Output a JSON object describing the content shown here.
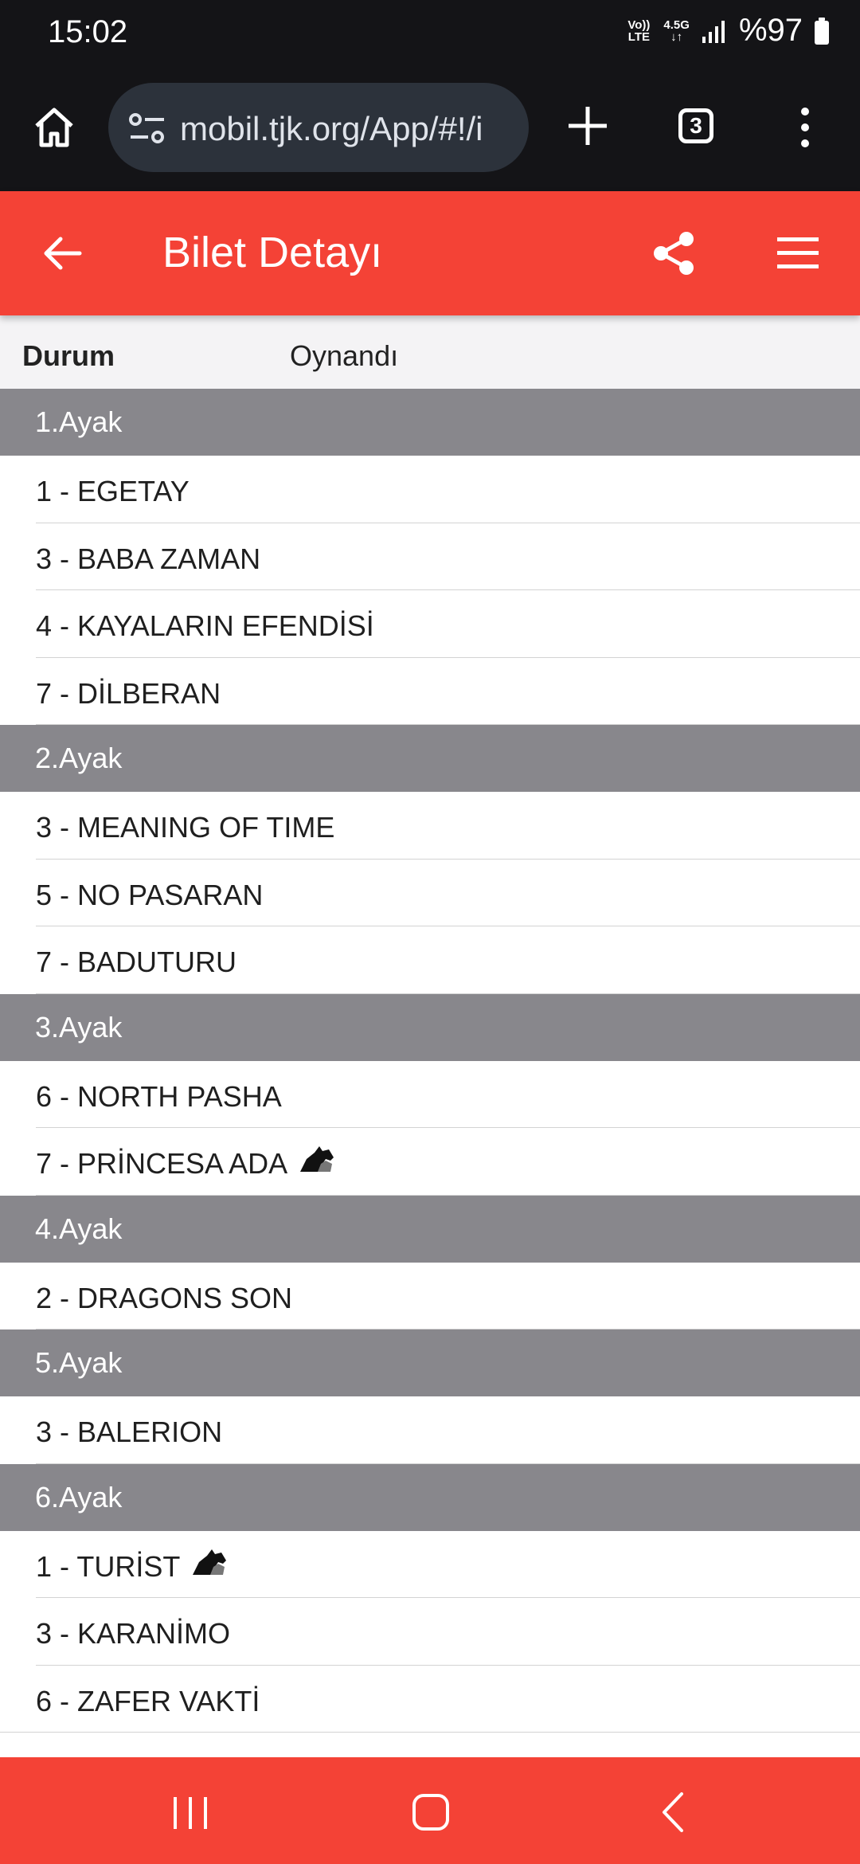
{
  "status_bar": {
    "time": "15:02",
    "volte": "Vo)) LTE",
    "network": "4.5G",
    "battery": "%97"
  },
  "browser": {
    "url": "mobil.tjk.org/App/#!/i",
    "tab_count": "3",
    "icons": [
      "home-icon",
      "tune-icon",
      "plus-icon",
      "tabs-icon",
      "more-vert-icon"
    ]
  },
  "header": {
    "title": "Bilet Detayı",
    "color": "#f44236",
    "icons": [
      "arrow-back-icon",
      "share-icon",
      "menu-icon"
    ]
  },
  "status_row": {
    "label": "Durum",
    "value": "Oynandı"
  },
  "legs": [
    {
      "name": "1.Ayak",
      "horses": [
        {
          "text": "1 - EGETAY",
          "icon": false
        },
        {
          "text": "3 - BABA ZAMAN",
          "icon": false
        },
        {
          "text": "4 - KAYALARIN EFENDİSİ",
          "icon": false
        },
        {
          "text": "7 - DİLBERAN",
          "icon": false
        }
      ]
    },
    {
      "name": "2.Ayak",
      "horses": [
        {
          "text": "3 - MEANING OF TIME",
          "icon": false
        },
        {
          "text": "5 - NO PASARAN",
          "icon": false
        },
        {
          "text": "7 - BADUTURU",
          "icon": false
        }
      ]
    },
    {
      "name": "3.Ayak",
      "horses": [
        {
          "text": "6 - NORTH PASHA",
          "icon": false
        },
        {
          "text": "7 - PRİNCESA ADA",
          "icon": true
        }
      ]
    },
    {
      "name": "4.Ayak",
      "horses": [
        {
          "text": "2 - DRAGONS SON",
          "icon": false
        }
      ]
    },
    {
      "name": "5.Ayak",
      "horses": [
        {
          "text": "3 - BALERION",
          "icon": false
        }
      ]
    },
    {
      "name": "6.Ayak",
      "horses": [
        {
          "text": "1 - TURİST",
          "icon": true
        },
        {
          "text": "3 - KARANİMO",
          "icon": false
        },
        {
          "text": "6 - ZAFER VAKTİ",
          "icon": false
        }
      ]
    }
  ],
  "nav": {
    "icons": [
      "recents-icon",
      "home-icon",
      "back-icon"
    ]
  }
}
